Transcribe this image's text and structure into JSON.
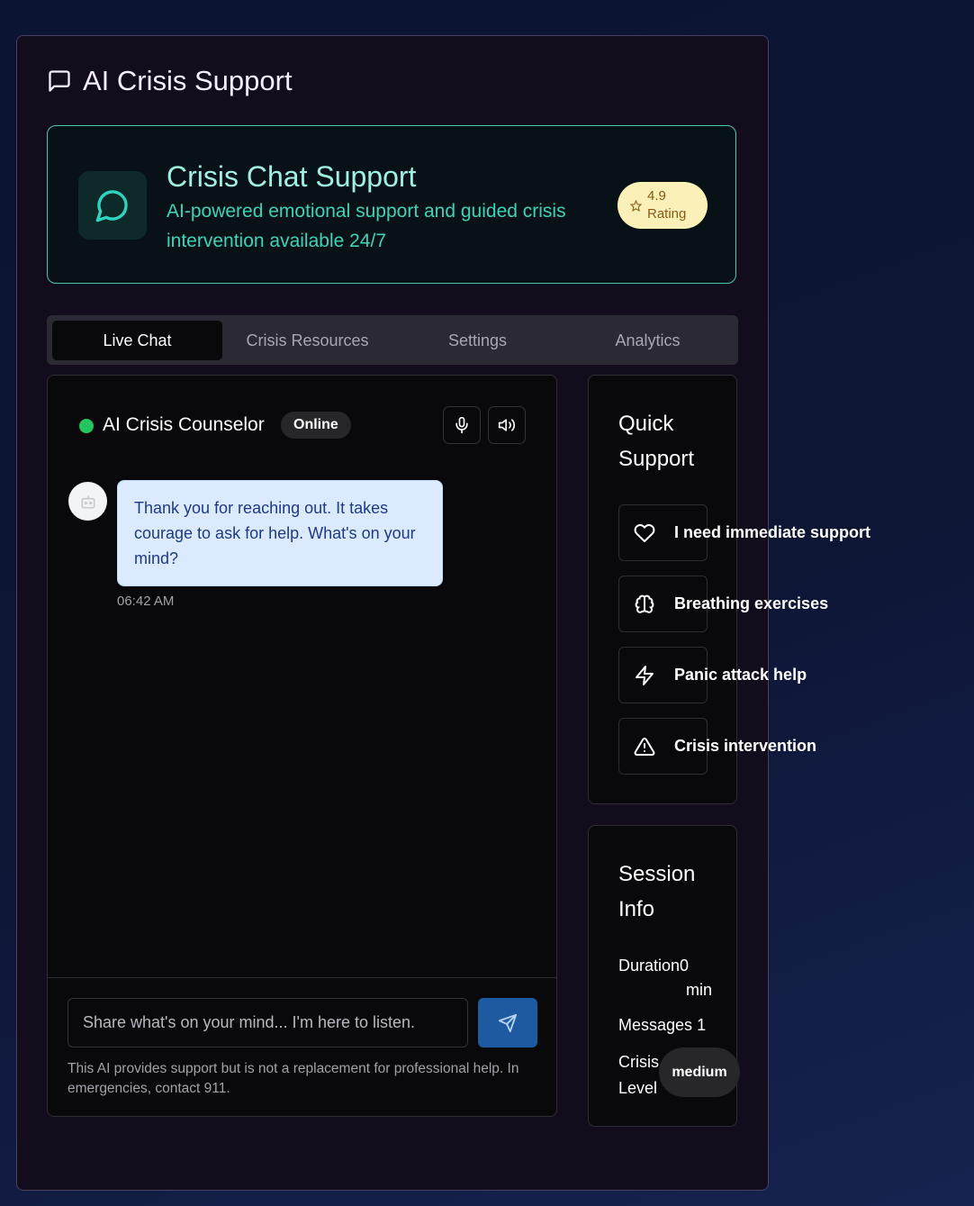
{
  "app": {
    "title": "AI Crisis Support",
    "title_icon": "message-square-icon"
  },
  "hero": {
    "title": "Crisis Chat Support",
    "subtitle": "AI-powered emotional support and guided crisis intervention available 24/7",
    "icon": "message-circle-icon",
    "rating_value": "4.9",
    "rating_label": "Rating",
    "accent": "#3cd3b6"
  },
  "tabs": [
    {
      "label": "Live Chat",
      "active": true
    },
    {
      "label": "Crisis Resources",
      "active": false
    },
    {
      "label": "Settings",
      "active": false
    },
    {
      "label": "Analytics",
      "active": false
    }
  ],
  "chat": {
    "counselor_name": "AI Crisis Counselor",
    "status": "Online",
    "status_color": "#22c55e",
    "messages": [
      {
        "sender": "bot",
        "text": "Thank you for reaching out. It takes courage to ask for help. What's on your mind?",
        "time": "06:42 AM"
      }
    ],
    "input_placeholder": "Share what's on your mind... I'm here to listen.",
    "disclaimer": "This AI provides support but is not a replacement for professional help. In emergencies, contact 911."
  },
  "quick_support": {
    "title": "Quick Support",
    "items": [
      {
        "label": "I need immediate support",
        "icon": "heart-icon"
      },
      {
        "label": "Breathing exercises",
        "icon": "brain-icon"
      },
      {
        "label": "Panic attack help",
        "icon": "zap-icon"
      },
      {
        "label": "Crisis intervention",
        "icon": "alert-triangle-icon"
      }
    ]
  },
  "session": {
    "title": "Session Info",
    "duration_label": "Duration",
    "duration_value": "0",
    "duration_unit": "min",
    "messages_label": "Messages",
    "messages_value": "1",
    "crisis_label": "Crisis Level",
    "crisis_value": "medium"
  }
}
